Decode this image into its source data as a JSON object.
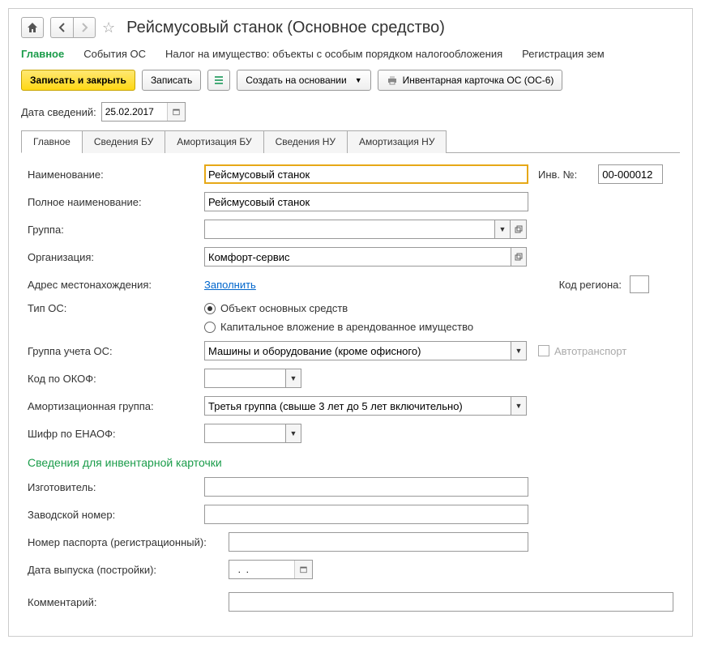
{
  "header": {
    "title": "Рейсмусовый станок (Основное средство)"
  },
  "topnav": {
    "main": "Главное",
    "events": "События ОС",
    "tax": "Налог на имущество: объекты с особым порядком налогообложения",
    "reg": "Регистрация зем"
  },
  "toolbar": {
    "save_close": "Записать и закрыть",
    "save": "Записать",
    "create_based": "Создать на основании",
    "inv_card": "Инвентарная карточка ОС (ОС-6)"
  },
  "date": {
    "label": "Дата сведений:",
    "value": "25.02.2017"
  },
  "tabs": {
    "t1": "Главное",
    "t2": "Сведения БУ",
    "t3": "Амортизация БУ",
    "t4": "Сведения НУ",
    "t5": "Амортизация НУ"
  },
  "form": {
    "name_label": "Наименование:",
    "name_value": "Рейсмусовый станок",
    "inv_label": "Инв. №:",
    "inv_value": "00-000012",
    "fullname_label": "Полное наименование:",
    "fullname_value": "Рейсмусовый станок",
    "group_label": "Группа:",
    "group_value": "",
    "org_label": "Организация:",
    "org_value": "Комфорт-сервис",
    "address_label": "Адрес местонахождения:",
    "address_link": "Заполнить",
    "region_label": "Код региона:",
    "type_label": "Тип ОС:",
    "type_opt1": "Объект основных средств",
    "type_opt2": "Капитальное вложение в арендованное имущество",
    "acct_group_label": "Группа учета ОС:",
    "acct_group_value": "Машины и оборудование (кроме офисного)",
    "auto_label": "Автотранспорт",
    "okof_label": "Код по ОКОФ:",
    "okof_value": "",
    "amort_group_label": "Амортизационная группа:",
    "amort_group_value": "Третья группа (свыше 3 лет до 5 лет включительно)",
    "enaof_label": "Шифр по ЕНАОФ:",
    "enaof_value": "",
    "card_section": "Сведения для инвентарной карточки",
    "maker_label": "Изготовитель:",
    "factory_num_label": "Заводской номер:",
    "passport_label": "Номер паспорта (регистрационный):",
    "release_date_label": "Дата выпуска (постройки):",
    "release_date_value": "  .  .    ",
    "comment_label": "Комментарий:"
  }
}
